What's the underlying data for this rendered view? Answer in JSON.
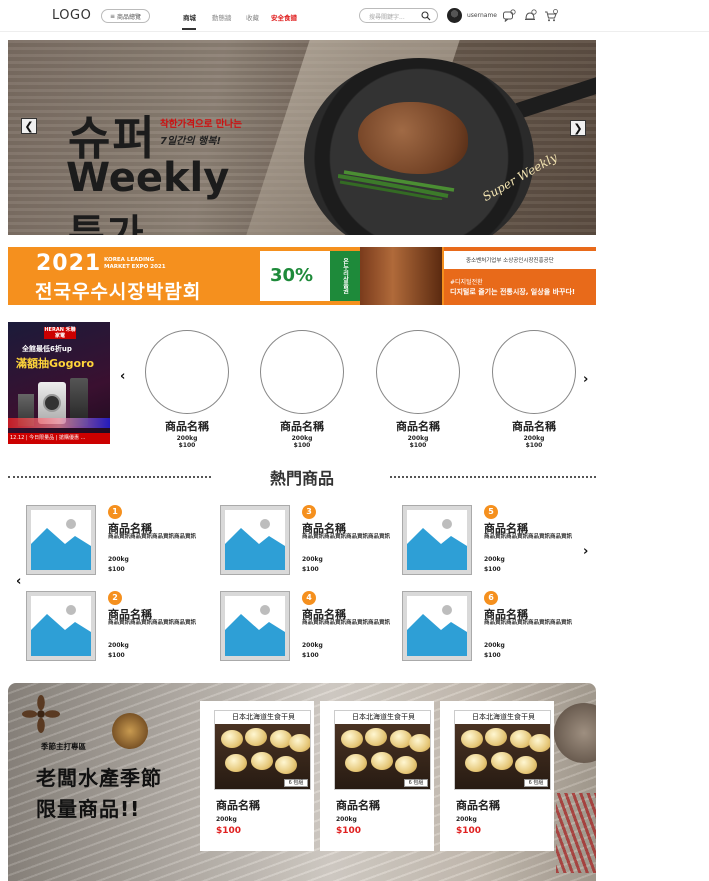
{
  "header": {
    "logo": "LOGO",
    "category_button": "商品總覽",
    "nav": [
      "商城",
      "動態牆",
      "收藏",
      "安全食譜"
    ],
    "search_placeholder": "搜尋關鍵字...",
    "username": "username",
    "icons": [
      "chat-icon",
      "bell-icon",
      "cart-icon"
    ]
  },
  "hero": {
    "title_line1": "슈퍼",
    "title_line2": "Weekly",
    "title_line3": "특가",
    "subtitle_line1": "착한가격으로 만나는",
    "subtitle_line2": "7일간의 행복!",
    "script_text": "Super Weekly",
    "prev": "❮",
    "next": "❯"
  },
  "expo": {
    "year": "2021",
    "small_line1": "KOREA LEADING",
    "small_line2": "MARKET EXPO 2021",
    "headline": "전국우수시장박람회",
    "percent": "30%",
    "green_tag": "온누리상품권",
    "logos_text": "중소벤처기업부   소상공인시장진흥공단",
    "right_line1": "#디지털전환",
    "right_line2": "디지털로 즐기는 전통시장, 일상을 바꾸다!"
  },
  "ad": {
    "brand": "HERAN 禾聯家電",
    "line1": "全館最低6折up",
    "line2": "滿額抽Gogoro",
    "footer": "12.12 | 今日限量品 | 搶購優惠 ..."
  },
  "carousel": {
    "prev": "‹",
    "next": "›",
    "items": [
      {
        "name": "商品名稱",
        "weight": "200kg",
        "price": "$100"
      },
      {
        "name": "商品名稱",
        "weight": "200kg",
        "price": "$100"
      },
      {
        "name": "商品名稱",
        "weight": "200kg",
        "price": "$100"
      },
      {
        "name": "商品名稱",
        "weight": "200kg",
        "price": "$100"
      }
    ]
  },
  "hot": {
    "title": "熱門商品",
    "prev": "‹",
    "next": "›",
    "items": [
      {
        "rank": "1",
        "name": "商品名稱",
        "desc": "商品資訊商品資訊商品資訊商品資訊",
        "weight": "200kg",
        "price": "$100"
      },
      {
        "rank": "2",
        "name": "商品名稱",
        "desc": "商品資訊商品資訊商品資訊商品資訊",
        "weight": "200kg",
        "price": "$100"
      },
      {
        "rank": "3",
        "name": "商品名稱",
        "desc": "商品資訊商品資訊商品資訊商品資訊",
        "weight": "200kg",
        "price": "$100"
      },
      {
        "rank": "4",
        "name": "商品名稱",
        "desc": "商品資訊商品資訊商品資訊商品資訊",
        "weight": "200kg",
        "price": "$100"
      },
      {
        "rank": "5",
        "name": "商品名稱",
        "desc": "商品資訊商品資訊商品資訊商品資訊",
        "weight": "200kg",
        "price": "$100"
      },
      {
        "rank": "6",
        "name": "商品名稱",
        "desc": "商品資訊商品資訊商品資訊商品資訊",
        "weight": "200kg",
        "price": "$100"
      }
    ]
  },
  "season": {
    "tag": "季節主打專區",
    "headline_line1": "老闆水產季節",
    "headline_line2": "限量商品!!",
    "cards": [
      {
        "image_label": "日本北海道生食干貝",
        "pack": "6 包組",
        "name": "商品名稱",
        "weight": "200kg",
        "price": "$100"
      },
      {
        "image_label": "日本北海道生食干貝",
        "pack": "6 包組",
        "name": "商品名稱",
        "weight": "200kg",
        "price": "$100"
      },
      {
        "image_label": "日本北海道生食干貝",
        "pack": "6 包組",
        "name": "商品名稱",
        "weight": "200kg",
        "price": "$100"
      }
    ]
  },
  "colors": {
    "accent": "#f5901e",
    "price_red": "#e02020",
    "placeholder_blue": "#2e9fd6"
  }
}
